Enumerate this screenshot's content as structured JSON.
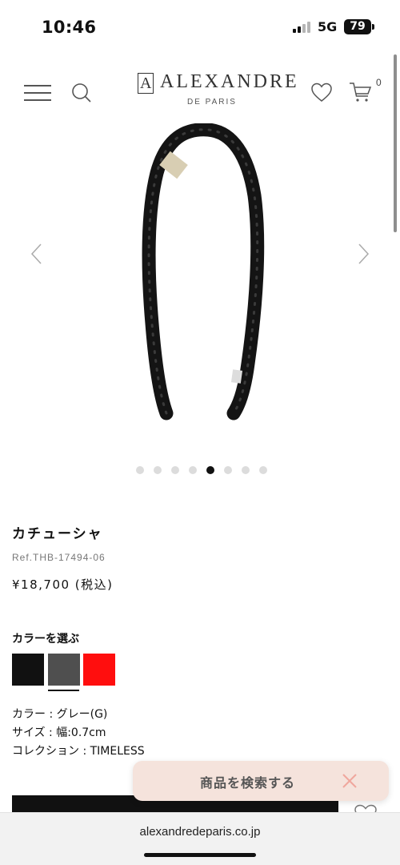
{
  "status_bar": {
    "time": "10:46",
    "network": "5G",
    "battery": "79"
  },
  "header": {
    "logo_word": "ALEXANDRE",
    "logo_mark": "A",
    "logo_sub": "DE PARIS",
    "cart_count": "0",
    "icons": [
      "menu-icon",
      "search-icon",
      "heart-icon",
      "cart-icon"
    ]
  },
  "gallery": {
    "image_count": 8,
    "active_index": 5,
    "icons": [
      "chevron-left-icon",
      "chevron-right-icon"
    ]
  },
  "product": {
    "name": "カチューシャ",
    "ref": "Ref.THB-17494-06",
    "price": "¥18,700 (税込)"
  },
  "colors": {
    "title": "カラーを選ぶ",
    "swatches": [
      {
        "name": "black",
        "hex": "#111111"
      },
      {
        "name": "grey",
        "hex": "#4f4f4f",
        "selected": true
      },
      {
        "name": "red",
        "hex": "#ff0e0e"
      }
    ]
  },
  "details": {
    "color": "カラー : グレー(G)",
    "size": "サイズ : 幅:0.7cm",
    "collection": "コレクション : TIMELESS"
  },
  "search_pill": {
    "label": "商品を検索する",
    "icon": "close-icon",
    "background": "#f5e3dc"
  },
  "browser": {
    "url": "alexandredeparis.co.jp"
  }
}
